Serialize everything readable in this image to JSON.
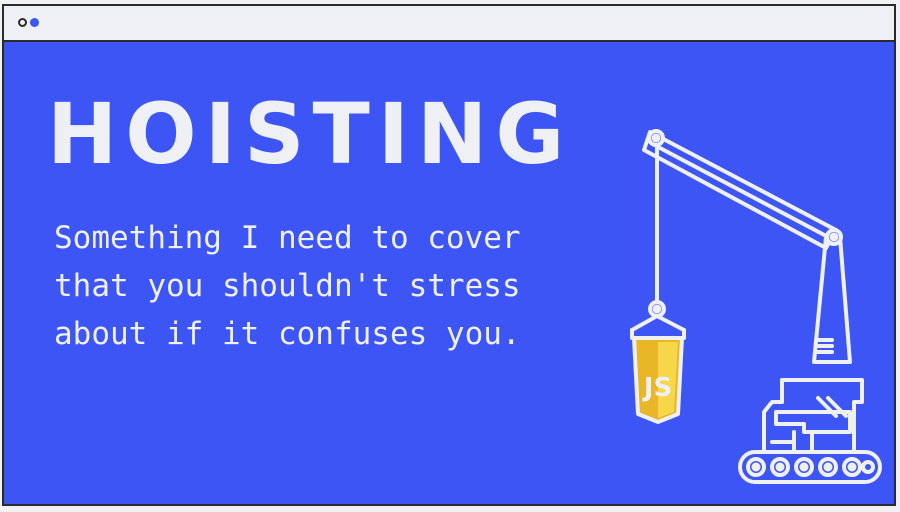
{
  "window": {
    "controls": [
      "window-dot-1",
      "window-dot-2"
    ]
  },
  "slide": {
    "title": "HOISTING",
    "subtitle_lines": [
      "Something I need to cover",
      "that you shouldn't stress",
      "about if it confuses you."
    ],
    "illustration": {
      "icon": "crane-icon",
      "badge_text": "JS"
    }
  },
  "colors": {
    "background": "#3d55f5",
    "text": "#eef0f4",
    "titlebar": "#eef0f4",
    "badge": "#e8b626",
    "badge_light": "#f7d64a",
    "outline": "#2b2b2b"
  }
}
